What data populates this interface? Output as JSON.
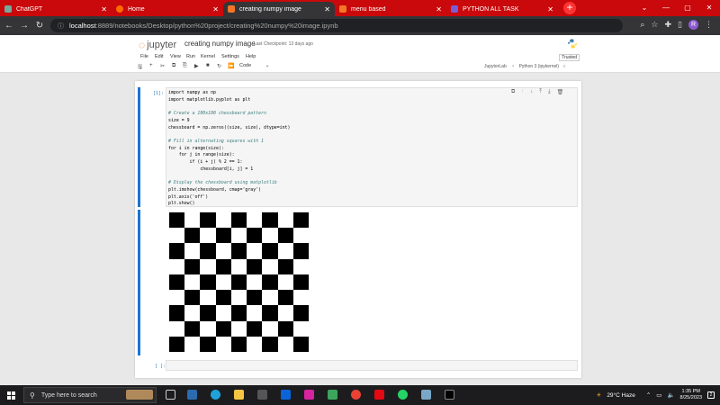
{
  "browser": {
    "tabs": [
      {
        "title": "ChatGPT",
        "color": "#74aa9c",
        "active": false
      },
      {
        "title": "Home",
        "color": "#ff6b00",
        "active": false
      },
      {
        "title": "creating numpy image",
        "color": "#f37726",
        "active": true
      },
      {
        "title": "menu based",
        "color": "#f37726",
        "active": false
      },
      {
        "title": "PYTHON ALL TASK",
        "color": "#7b5cd6",
        "active": false
      }
    ],
    "url_host": "localhost",
    "url_rest": ":8889/notebooks/Desktop/python%20project/creating%20numpy%20image.ipynb",
    "profile_initial": "R"
  },
  "jupyter": {
    "logo_text": "jupyter",
    "notebook_title": "creating numpy image",
    "checkpoint": "Last Checkpoint: 13 days ago",
    "menu": [
      "File",
      "Edit",
      "View",
      "Run",
      "Kernel",
      "Settings",
      "Help"
    ],
    "trusted": "Trusted",
    "cell_type": "Code",
    "jupyterlab_label": "JupyterLab",
    "kernel_name": "Python 3 (ipykernel)"
  },
  "cells": {
    "cell1_prompt": "[1]:",
    "cell2_prompt": "[ ]:",
    "code_lines": [
      "import numpy as np",
      "import matplotlib.pyplot as plt",
      "",
      "# Create a 100x100 chessboard pattern",
      "size = 9",
      "chessboard = np.zeros((size, size), dtype=int)",
      "",
      "# Fill in alternating squares with 1",
      "for i in range(size):",
      "    for j in range(size):",
      "        if (i + j) % 2 == 1:",
      "            chessboard[i, j] = 1",
      "",
      "# Display the chessboard using matplotlib",
      "plt.imshow(chessboard, cmap='gray')",
      "plt.axis('off')",
      "plt.show()"
    ],
    "chessboard_size": 9
  },
  "taskbar": {
    "search_placeholder": "Type here to search",
    "weather": "29°C  Haze",
    "time": "1:35 PM",
    "date": "8/25/2023",
    "notifications": "2"
  }
}
